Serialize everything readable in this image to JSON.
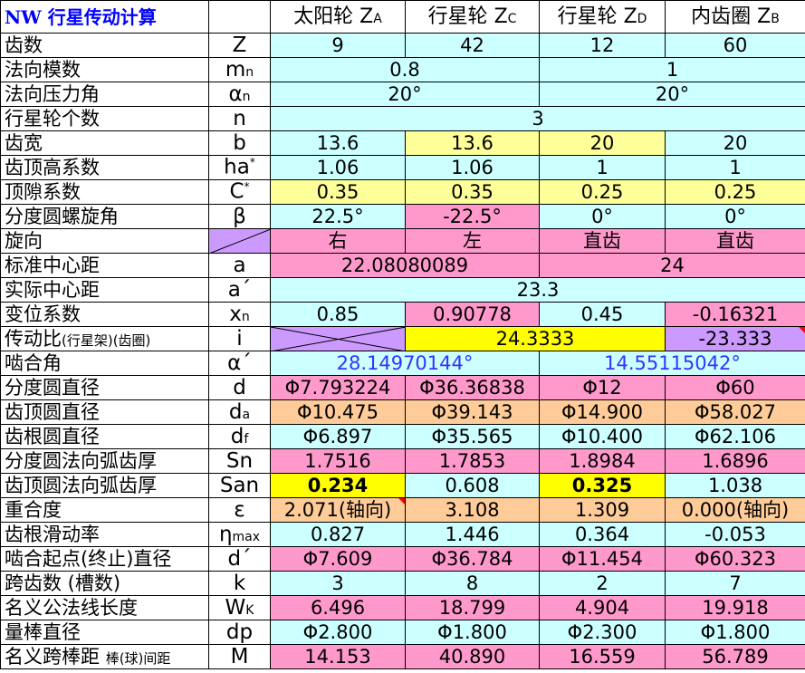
{
  "title": "NW 行星传动计算",
  "columns": [
    {
      "name": "太阳轮",
      "sym": "Z",
      "sub": "A"
    },
    {
      "name": "行星轮",
      "sym": "Z",
      "sub": "C"
    },
    {
      "name": "行星轮",
      "sym": "Z",
      "sub": "D"
    },
    {
      "name": "内齿圈",
      "sym": "Z",
      "sub": "B"
    }
  ],
  "rows": {
    "teeth": {
      "label": "齿数",
      "sym": "Z",
      "values": [
        "9",
        "42",
        "12",
        "60"
      ]
    },
    "module": {
      "label": "法向模数",
      "sym": "m",
      "sub": "n",
      "values": [
        "0.8",
        "1"
      ]
    },
    "pressure_angle": {
      "label": "法向压力角",
      "sym": "α",
      "sub": "n",
      "values": [
        "20°",
        "20°"
      ]
    },
    "planet_count": {
      "label": "行星轮个数",
      "sym": "n",
      "value": "3"
    },
    "face_width": {
      "label": "齿宽",
      "sym": "b",
      "values": [
        "13.6",
        "13.6",
        "20",
        "20"
      ]
    },
    "addendum_coef": {
      "label": "齿顶高系数",
      "sym": "ha",
      "sup": "*",
      "values": [
        "1.06",
        "1.06",
        "1",
        "1"
      ]
    },
    "clearance_coef": {
      "label": "顶隙系数",
      "sym": "C",
      "sup": "*",
      "values": [
        "0.35",
        "0.35",
        "0.25",
        "0.25"
      ]
    },
    "helix_angle": {
      "label": "分度圆螺旋角",
      "sym": "β",
      "values": [
        "22.5°",
        "-22.5°",
        "0°",
        "0°"
      ]
    },
    "hand": {
      "label": "旋向",
      "values": [
        "右",
        "左",
        "直齿",
        "直齿"
      ]
    },
    "std_center": {
      "label": "标准中心距",
      "sym": "a",
      "values": [
        "22.08080089",
        "24"
      ]
    },
    "actual_center": {
      "label": "实际中心距",
      "sym": "a´",
      "value": "23.3"
    },
    "shift_coef": {
      "label": "变位系数",
      "sym": "x",
      "sub": "n",
      "values": [
        "0.85",
        "0.90778",
        "0.45",
        "-0.16321"
      ]
    },
    "ratio": {
      "label": "传动比",
      "label_small": "(行星架)(齿圈)",
      "sym": "i",
      "values": [
        "24.3333",
        "-23.333"
      ]
    },
    "mesh_angle": {
      "label": "啮合角",
      "sym": "α´",
      "values": [
        "28.14970144°",
        "14.55115042°"
      ]
    },
    "pitch_dia": {
      "label": "分度圆直径",
      "sym": "d",
      "values": [
        "Φ7.793224",
        "Φ36.36838",
        "Φ12",
        "Φ60"
      ]
    },
    "tip_dia": {
      "label": "齿顶圆直径",
      "sym": "d",
      "sub": "a",
      "values": [
        "Φ10.475",
        "Φ39.143",
        "Φ14.900",
        "Φ58.027"
      ]
    },
    "root_dia": {
      "label": "齿根圆直径",
      "sym": "d",
      "sub": "f",
      "values": [
        "Φ6.897",
        "Φ35.565",
        "Φ10.400",
        "Φ62.106"
      ]
    },
    "tooth_thk": {
      "label": "分度圆法向弧齿厚",
      "sym": "Sn",
      "values": [
        "1.7516",
        "1.7853",
        "1.8984",
        "1.6896"
      ]
    },
    "tip_thk": {
      "label": "齿顶圆法向弧齿厚",
      "sym": "San",
      "values": [
        "0.234",
        "0.608",
        "0.325",
        "1.038"
      ]
    },
    "contact_ratio": {
      "label": "重合度",
      "sym": "ε",
      "values": [
        "2.071(轴向)",
        "3.108",
        "1.309",
        "0.000(轴向)"
      ]
    },
    "slide_ratio": {
      "label": "齿根滑动率",
      "sym": "η",
      "sub": "max",
      "values": [
        "0.827",
        "1.446",
        "0.364",
        "-0.053"
      ]
    },
    "mesh_start_dia": {
      "label": "啮合起点(终止)直径",
      "sym": "d´",
      "values": [
        "Φ7.609",
        "Φ36.784",
        "Φ11.454",
        "Φ60.323"
      ]
    },
    "span_teeth": {
      "label": "跨齿数 (槽数)",
      "sym": "k",
      "values": [
        "3",
        "8",
        "2",
        "7"
      ]
    },
    "base_tangent": {
      "label": "名义公法线长度",
      "sym": "W",
      "sub": "K",
      "values": [
        "6.496",
        "18.799",
        "4.904",
        "19.918"
      ]
    },
    "pin_dia": {
      "label": "量棒直径",
      "sym": "dp",
      "values": [
        "Φ2.800",
        "Φ1.800",
        "Φ2.300",
        "Φ1.800"
      ]
    },
    "over_pins": {
      "label": "名义跨棒距",
      "label_small": "棒(球)间距",
      "sym": "M",
      "values": [
        "14.153",
        "40.890",
        "16.559",
        "56.789"
      ]
    }
  },
  "colors": {
    "cyan": "#ccffff",
    "light_yellow": "#ffff99",
    "pink": "#ff99cc",
    "orange": "#ffcc99",
    "violet": "#cc99ff",
    "yellow": "#ffff00",
    "title_blue": "#0000ff",
    "angle_blue": "#3333ff"
  }
}
